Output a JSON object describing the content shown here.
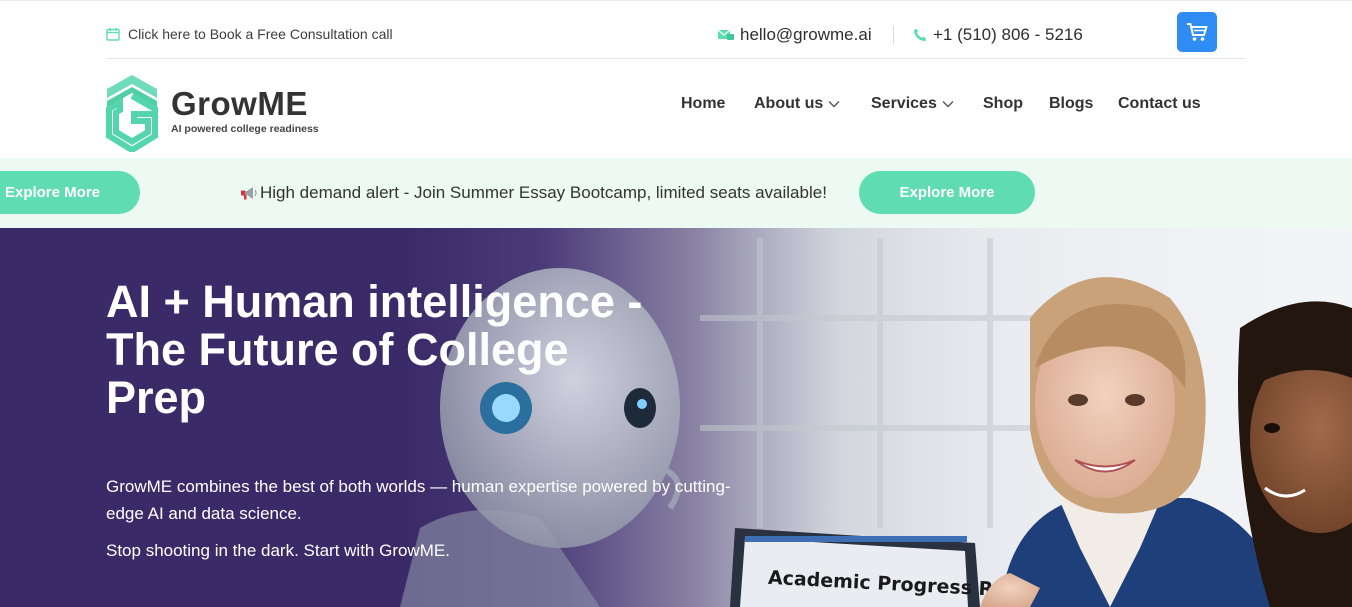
{
  "topbar": {
    "consult_text": "Click here to Book a Free Consultation call",
    "email": "hello@growme.ai",
    "phone": "+1 (510) 806 - 5216"
  },
  "brand": {
    "name": "GrowME",
    "tagline": "AI powered college readiness"
  },
  "nav": {
    "items": [
      {
        "label": "Home"
      },
      {
        "label": "About us"
      },
      {
        "label": "Services"
      },
      {
        "label": "Shop"
      },
      {
        "label": "Blogs"
      },
      {
        "label": "Contact us"
      }
    ]
  },
  "announcement": {
    "text": "High demand alert - Join Summer Essay Bootcamp, limited seats available!",
    "button_label": "Explore More",
    "icon": "megaphone-icon"
  },
  "hero": {
    "title": "AI + Human intelligence - The Future of College Prep",
    "paragraph1": "GrowME combines the best of both worlds — human expertise powered by cutting-edge AI and data science.",
    "paragraph2": "Stop shooting in the dark. Start with GrowME.",
    "report_label": "Academic Progress Report"
  },
  "colors": {
    "accent_green": "#5fdcb1",
    "cart_blue": "#2f8cf4",
    "hero_purple": "#3a2a68",
    "announce_bg": "#ecfaf3"
  }
}
